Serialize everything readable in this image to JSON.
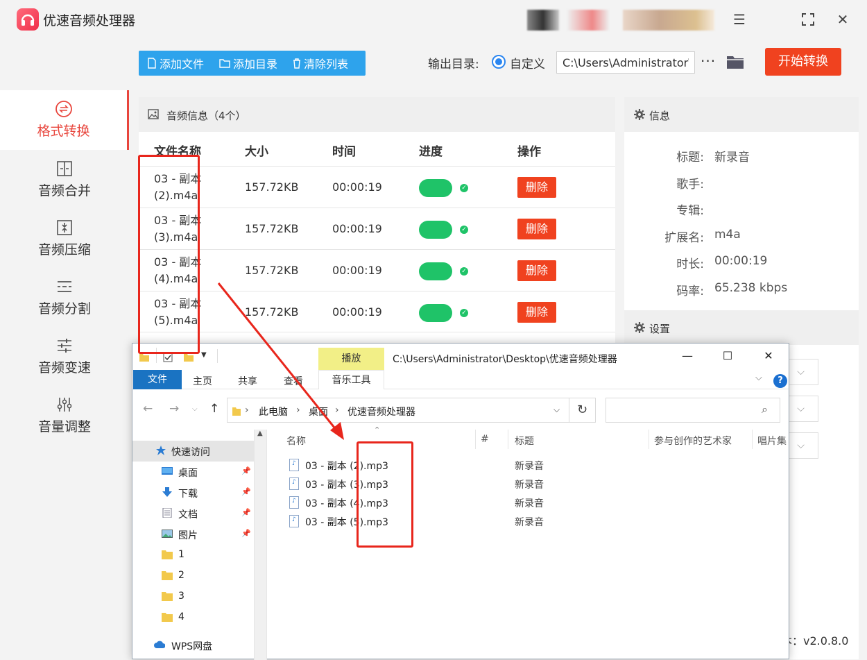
{
  "app": {
    "title": "优速音频处理器",
    "version": "本：v2.0.8.0"
  },
  "sidebar": {
    "items": [
      {
        "label": "格式转换",
        "icon": "format-convert-icon",
        "active": true
      },
      {
        "label": "音频合并",
        "icon": "merge-icon"
      },
      {
        "label": "音频压缩",
        "icon": "compress-icon"
      },
      {
        "label": "音频分割",
        "icon": "split-icon"
      },
      {
        "label": "音频变速",
        "icon": "speed-icon"
      },
      {
        "label": "音量调整",
        "icon": "volume-icon"
      }
    ]
  },
  "toolbar": {
    "add_file": "添加文件",
    "add_dir": "添加目录",
    "clear_list": "清除列表",
    "output_label": "输出目录:",
    "radio_label": "自定义",
    "path_value": "C:\\Users\\Administrator\\",
    "more": "···",
    "start": "开始转换"
  },
  "audio_panel": {
    "title": "音频信息（4个）",
    "columns": [
      "文件名称",
      "大小",
      "时间",
      "进度",
      "操作"
    ],
    "rows": [
      {
        "name": "03 - 副本 (2).m4a",
        "size": "157.72KB",
        "time": "00:00:19",
        "action": "删除"
      },
      {
        "name": "03 - 副本 (3).m4a",
        "size": "157.72KB",
        "time": "00:00:19",
        "action": "删除"
      },
      {
        "name": "03 - 副本 (4).m4a",
        "size": "157.72KB",
        "time": "00:00:19",
        "action": "删除"
      },
      {
        "name": "03 - 副本 (5).m4a",
        "size": "157.72KB",
        "time": "00:00:19",
        "action": "删除"
      }
    ]
  },
  "info_panel": {
    "title": "信息",
    "fields": [
      {
        "key": "标题:",
        "value": "新录音"
      },
      {
        "key": "歌手:",
        "value": ""
      },
      {
        "key": "专辑:",
        "value": ""
      },
      {
        "key": "扩展名:",
        "value": "m4a"
      },
      {
        "key": "时长:",
        "value": "00:00:19"
      },
      {
        "key": "码率:",
        "value": "65.238 kbps"
      }
    ],
    "settings_title": "设置"
  },
  "explorer": {
    "title_path": "C:\\Users\\Administrator\\Desktop\\优速音频处理器",
    "play_tab": "播放",
    "music_tools_tab": "音乐工具",
    "tabs": [
      "文件",
      "主页",
      "共享",
      "查看"
    ],
    "breadcrumb": [
      "此电脑",
      "桌面",
      "优速音频处理器"
    ],
    "nav_items": [
      {
        "label": "快速访问",
        "icon": "star-icon"
      },
      {
        "label": "桌面",
        "icon": "desktop-icon",
        "pinned": true
      },
      {
        "label": "下载",
        "icon": "download-icon",
        "pinned": true
      },
      {
        "label": "文档",
        "icon": "document-icon",
        "pinned": true
      },
      {
        "label": "图片",
        "icon": "picture-icon",
        "pinned": true
      },
      {
        "label": "1",
        "icon": "folder-icon"
      },
      {
        "label": "2",
        "icon": "folder-icon"
      },
      {
        "label": "3",
        "icon": "folder-icon"
      },
      {
        "label": "4",
        "icon": "folder-icon"
      },
      {
        "label": "WPS网盘",
        "icon": "cloud-icon"
      }
    ],
    "columns": [
      "名称",
      "#",
      "标题",
      "参与创作的艺术家",
      "唱片集"
    ],
    "files": [
      {
        "name": "03 - 副本 (2).mp3",
        "title": "新录音"
      },
      {
        "name": "03 - 副本 (3).mp3",
        "title": "新录音"
      },
      {
        "name": "03 - 副本 (4).mp3",
        "title": "新录音"
      },
      {
        "name": "03 - 副本 (5).mp3",
        "title": "新录音"
      }
    ]
  },
  "colors": {
    "accent_red": "#f0421f",
    "toolbar_blue": "#2ea3ec",
    "progress_green": "#1fc368",
    "annotation_red": "#e8261c"
  }
}
